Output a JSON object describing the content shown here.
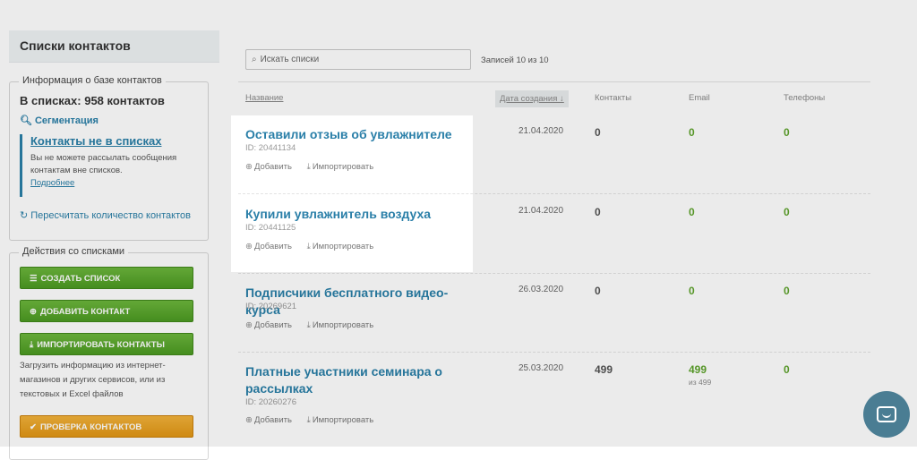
{
  "sidebar": {
    "title": "Списки контактов",
    "info_legend": "Информация о базе контактов",
    "total_label": "В списках: 958 контактов",
    "segmentation": "Сегментация",
    "not_in_lists_title": "Контакты не в списках",
    "not_in_lists_text": "Вы не можете рассылать сообщения контактам вне списков.",
    "more_link": "Подробнее",
    "recount": "Пересчитать количество контактов",
    "actions_legend": "Действия со списками",
    "buttons": {
      "create_list": "Создать список",
      "add_contact": "Добавить контакт",
      "import_contacts": "Импортировать контакты",
      "check_contacts": "Проверка контактов"
    },
    "upload_note": "Загрузить информацию из интернет-магазинов и других сервисов, или из текстовых и Excel файлов"
  },
  "search": {
    "placeholder": "Искать списки"
  },
  "records_count": "Записей 10 из 10",
  "table": {
    "columns": {
      "name": "Название",
      "created": "Дата создания ↓",
      "contacts": "Контакты",
      "email": "Email",
      "phones": "Телефоны"
    },
    "action_add": "Добавить",
    "action_import": "Импортировать",
    "rows": [
      {
        "title": "Оставили отзыв об увлажнителе",
        "id": "ID: 20441134",
        "date": "21.04.2020",
        "contacts": "0",
        "email": "0",
        "email_sub": "",
        "phones": "0"
      },
      {
        "title": "Купили увлажнитель воздуха",
        "id": "ID: 20441125",
        "date": "21.04.2020",
        "contacts": "0",
        "email": "0",
        "email_sub": "",
        "phones": "0"
      },
      {
        "title": "Подписчики бесплатного видео-курса",
        "id": "ID: 20269621",
        "date": "26.03.2020",
        "contacts": "0",
        "email": "0",
        "email_sub": "",
        "phones": "0"
      },
      {
        "title": "Платные участники семинара о рассылках",
        "id": "ID: 20260276",
        "date": "25.03.2020",
        "contacts": "499",
        "email": "499",
        "email_sub": "из 499",
        "phones": "0"
      }
    ]
  },
  "icons": {
    "search": "search-icon",
    "segmentation": "search-icon",
    "recount": "refresh-icon",
    "list": "list-icon",
    "plus": "plus-circle-icon",
    "download": "download-icon",
    "check": "check-icon",
    "chat": "chat-icon"
  },
  "colors": {
    "accent_blue": "#2a7fa8",
    "green_button": "#5aa62c",
    "orange_button": "#e8a325",
    "positive_green": "#5ea32c",
    "chat_button": "#4a7d93"
  }
}
